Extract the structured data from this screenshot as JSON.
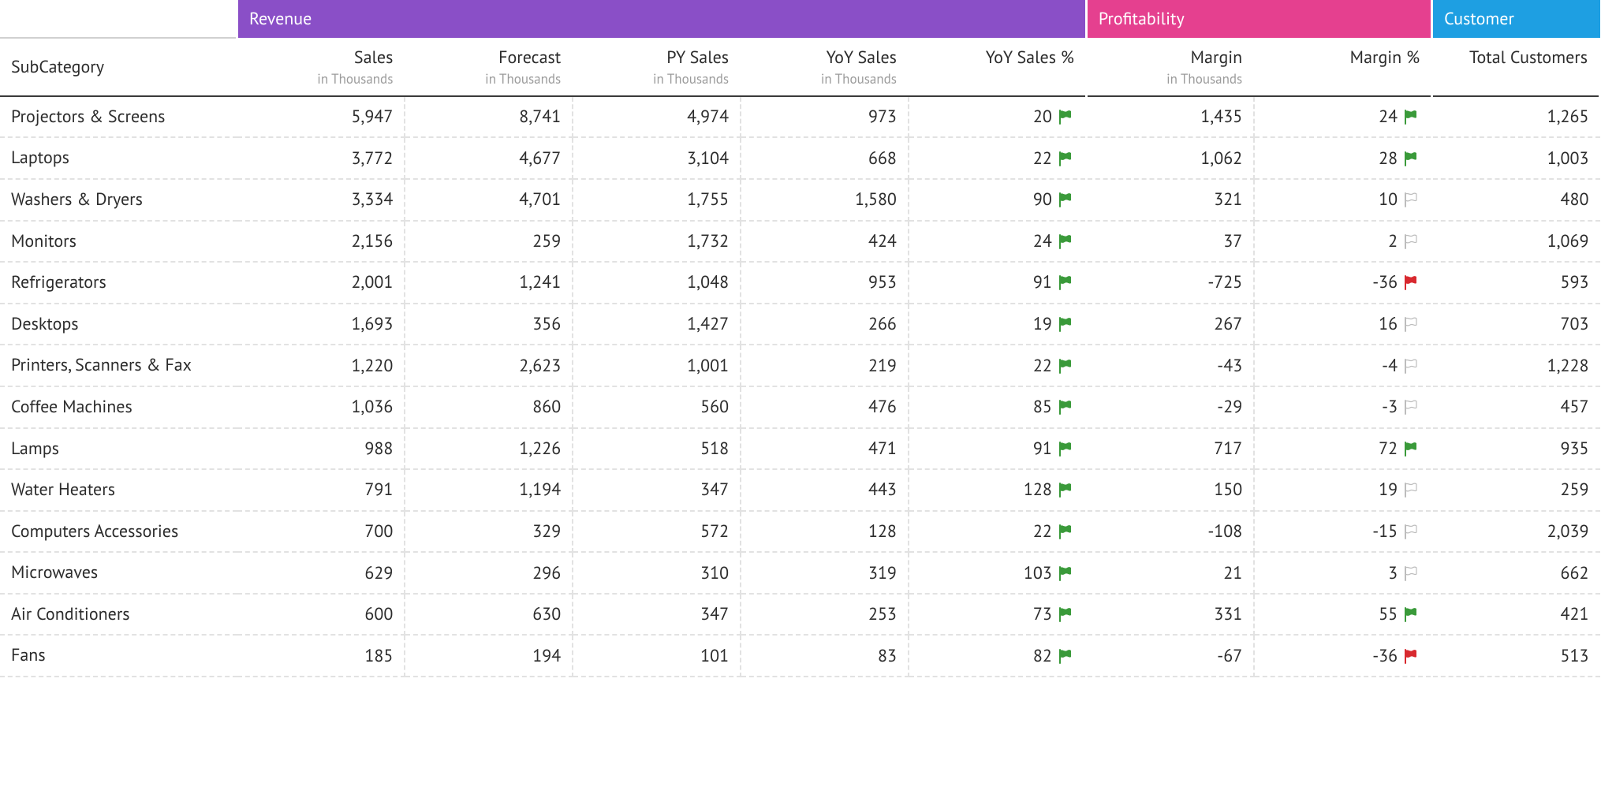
{
  "groups": [
    {
      "key": "revenue",
      "label": "Revenue",
      "color": "#8a4fc7",
      "span": 5
    },
    {
      "key": "profitability",
      "label": "Profitability",
      "color": "#e5408f",
      "span": 2
    },
    {
      "key": "customer",
      "label": "Customer",
      "color": "#1e9fe2",
      "span": 1
    }
  ],
  "row_header_label": "SubCategory",
  "columns": [
    {
      "key": "sales",
      "label": "Sales",
      "sub": "in Thousands",
      "group": "revenue"
    },
    {
      "key": "forecast",
      "label": "Forecast",
      "sub": "in Thousands",
      "group": "revenue"
    },
    {
      "key": "py_sales",
      "label": "PY Sales",
      "sub": "in Thousands",
      "group": "revenue"
    },
    {
      "key": "yoy_sales",
      "label": "YoY Sales",
      "sub": "in Thousands",
      "group": "revenue"
    },
    {
      "key": "yoy_sales_pct",
      "label": "YoY Sales %",
      "sub": "",
      "group": "revenue",
      "flag": true
    },
    {
      "key": "margin",
      "label": "Margin",
      "sub": "in Thousands",
      "group": "profitability"
    },
    {
      "key": "margin_pct",
      "label": "Margin %",
      "sub": "",
      "group": "profitability",
      "flag": true
    },
    {
      "key": "total_customers",
      "label": "Total Customers",
      "sub": "",
      "group": "customer"
    }
  ],
  "rows": [
    {
      "label": "Projectors & Screens",
      "sales": "5,947",
      "forecast": "8,741",
      "py_sales": "4,974",
      "yoy_sales": "973",
      "yoy_sales_pct": {
        "v": "20",
        "flag": "green"
      },
      "margin": "1,435",
      "margin_pct": {
        "v": "24",
        "flag": "green"
      },
      "total_customers": "1,265"
    },
    {
      "label": "Laptops",
      "sales": "3,772",
      "forecast": "4,677",
      "py_sales": "3,104",
      "yoy_sales": "668",
      "yoy_sales_pct": {
        "v": "22",
        "flag": "green"
      },
      "margin": "1,062",
      "margin_pct": {
        "v": "28",
        "flag": "green"
      },
      "total_customers": "1,003"
    },
    {
      "label": "Washers & Dryers",
      "sales": "3,334",
      "forecast": "4,701",
      "py_sales": "1,755",
      "yoy_sales": "1,580",
      "yoy_sales_pct": {
        "v": "90",
        "flag": "green"
      },
      "margin": "321",
      "margin_pct": {
        "v": "10",
        "flag": "grey"
      },
      "total_customers": "480"
    },
    {
      "label": "Monitors",
      "sales": "2,156",
      "forecast": "259",
      "py_sales": "1,732",
      "yoy_sales": "424",
      "yoy_sales_pct": {
        "v": "24",
        "flag": "green"
      },
      "margin": "37",
      "margin_pct": {
        "v": "2",
        "flag": "grey"
      },
      "total_customers": "1,069"
    },
    {
      "label": "Refrigerators",
      "sales": "2,001",
      "forecast": "1,241",
      "py_sales": "1,048",
      "yoy_sales": "953",
      "yoy_sales_pct": {
        "v": "91",
        "flag": "green"
      },
      "margin": "-725",
      "margin_pct": {
        "v": "-36",
        "flag": "red"
      },
      "total_customers": "593"
    },
    {
      "label": "Desktops",
      "sales": "1,693",
      "forecast": "356",
      "py_sales": "1,427",
      "yoy_sales": "266",
      "yoy_sales_pct": {
        "v": "19",
        "flag": "green"
      },
      "margin": "267",
      "margin_pct": {
        "v": "16",
        "flag": "grey"
      },
      "total_customers": "703"
    },
    {
      "label": "Printers, Scanners & Fax",
      "sales": "1,220",
      "forecast": "2,623",
      "py_sales": "1,001",
      "yoy_sales": "219",
      "yoy_sales_pct": {
        "v": "22",
        "flag": "green"
      },
      "margin": "-43",
      "margin_pct": {
        "v": "-4",
        "flag": "grey"
      },
      "total_customers": "1,228"
    },
    {
      "label": "Coffee Machines",
      "sales": "1,036",
      "forecast": "860",
      "py_sales": "560",
      "yoy_sales": "476",
      "yoy_sales_pct": {
        "v": "85",
        "flag": "green"
      },
      "margin": "-29",
      "margin_pct": {
        "v": "-3",
        "flag": "grey"
      },
      "total_customers": "457"
    },
    {
      "label": "Lamps",
      "sales": "988",
      "forecast": "1,226",
      "py_sales": "518",
      "yoy_sales": "471",
      "yoy_sales_pct": {
        "v": "91",
        "flag": "green"
      },
      "margin": "717",
      "margin_pct": {
        "v": "72",
        "flag": "green"
      },
      "total_customers": "935"
    },
    {
      "label": "Water Heaters",
      "sales": "791",
      "forecast": "1,194",
      "py_sales": "347",
      "yoy_sales": "443",
      "yoy_sales_pct": {
        "v": "128",
        "flag": "green"
      },
      "margin": "150",
      "margin_pct": {
        "v": "19",
        "flag": "grey"
      },
      "total_customers": "259"
    },
    {
      "label": "Computers Accessories",
      "sales": "700",
      "forecast": "329",
      "py_sales": "572",
      "yoy_sales": "128",
      "yoy_sales_pct": {
        "v": "22",
        "flag": "green"
      },
      "margin": "-108",
      "margin_pct": {
        "v": "-15",
        "flag": "grey"
      },
      "total_customers": "2,039"
    },
    {
      "label": "Microwaves",
      "sales": "629",
      "forecast": "296",
      "py_sales": "310",
      "yoy_sales": "319",
      "yoy_sales_pct": {
        "v": "103",
        "flag": "green"
      },
      "margin": "21",
      "margin_pct": {
        "v": "3",
        "flag": "grey"
      },
      "total_customers": "662"
    },
    {
      "label": "Air Conditioners",
      "sales": "600",
      "forecast": "630",
      "py_sales": "347",
      "yoy_sales": "253",
      "yoy_sales_pct": {
        "v": "73",
        "flag": "green"
      },
      "margin": "331",
      "margin_pct": {
        "v": "55",
        "flag": "green"
      },
      "total_customers": "421"
    },
    {
      "label": "Fans",
      "sales": "185",
      "forecast": "194",
      "py_sales": "101",
      "yoy_sales": "83",
      "yoy_sales_pct": {
        "v": "82",
        "flag": "green"
      },
      "margin": "-67",
      "margin_pct": {
        "v": "-36",
        "flag": "red"
      },
      "total_customers": "513"
    }
  ],
  "chart_data": {
    "type": "table",
    "row_dimension": "SubCategory",
    "column_groups": {
      "Revenue": [
        "Sales",
        "Forecast",
        "PY Sales",
        "YoY Sales",
        "YoY Sales %"
      ],
      "Profitability": [
        "Margin",
        "Margin %"
      ],
      "Customer": [
        "Total Customers"
      ]
    },
    "units": {
      "Sales": "Thousands",
      "Forecast": "Thousands",
      "PY Sales": "Thousands",
      "YoY Sales": "Thousands",
      "Margin": "Thousands"
    },
    "series": [
      {
        "name": "Sales",
        "values": [
          5947,
          3772,
          3334,
          2156,
          2001,
          1693,
          1220,
          1036,
          988,
          791,
          700,
          629,
          600,
          185
        ]
      },
      {
        "name": "Forecast",
        "values": [
          8741,
          4677,
          4701,
          259,
          1241,
          356,
          2623,
          860,
          1226,
          1194,
          329,
          296,
          630,
          194
        ]
      },
      {
        "name": "PY Sales",
        "values": [
          4974,
          3104,
          1755,
          1732,
          1048,
          1427,
          1001,
          560,
          518,
          347,
          572,
          310,
          347,
          101
        ]
      },
      {
        "name": "YoY Sales",
        "values": [
          973,
          668,
          1580,
          424,
          953,
          266,
          219,
          476,
          471,
          443,
          128,
          319,
          253,
          83
        ]
      },
      {
        "name": "YoY Sales %",
        "values": [
          20,
          22,
          90,
          24,
          91,
          19,
          22,
          85,
          91,
          128,
          22,
          103,
          73,
          82
        ]
      },
      {
        "name": "Margin",
        "values": [
          1435,
          1062,
          321,
          37,
          -725,
          267,
          -43,
          -29,
          717,
          150,
          -108,
          21,
          331,
          -67
        ]
      },
      {
        "name": "Margin %",
        "values": [
          24,
          28,
          10,
          2,
          -36,
          16,
          -4,
          -3,
          72,
          19,
          -15,
          3,
          55,
          -36
        ]
      },
      {
        "name": "Total Customers",
        "values": [
          1265,
          1003,
          480,
          1069,
          593,
          703,
          1228,
          457,
          935,
          259,
          2039,
          662,
          421,
          513
        ]
      }
    ],
    "categories": [
      "Projectors & Screens",
      "Laptops",
      "Washers & Dryers",
      "Monitors",
      "Refrigerators",
      "Desktops",
      "Printers, Scanners & Fax",
      "Coffee Machines",
      "Lamps",
      "Water Heaters",
      "Computers Accessories",
      "Microwaves",
      "Air Conditioners",
      "Fans"
    ],
    "flags": {
      "YoY Sales %": [
        "green",
        "green",
        "green",
        "green",
        "green",
        "green",
        "green",
        "green",
        "green",
        "green",
        "green",
        "green",
        "green",
        "green"
      ],
      "Margin %": [
        "green",
        "green",
        "grey",
        "grey",
        "red",
        "grey",
        "grey",
        "grey",
        "green",
        "grey",
        "grey",
        "grey",
        "green",
        "red"
      ]
    }
  }
}
